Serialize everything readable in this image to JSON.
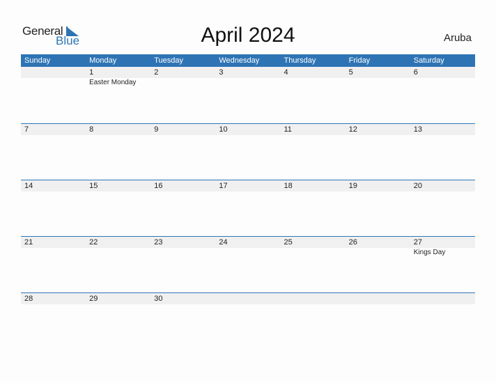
{
  "logo": {
    "word1": "General",
    "word2": "Blue",
    "icon": "triangle-flag-icon",
    "brand_color": "#2e74b5"
  },
  "title": "April 2024",
  "country": "Aruba",
  "header_color": "#2e74b5",
  "days": [
    "Sunday",
    "Monday",
    "Tuesday",
    "Wednesday",
    "Thursday",
    "Friday",
    "Saturday"
  ],
  "weeks": [
    {
      "dates": [
        "",
        "1",
        "2",
        "3",
        "4",
        "5",
        "6"
      ],
      "events": [
        "",
        "Easter Monday",
        "",
        "",
        "",
        "",
        ""
      ]
    },
    {
      "dates": [
        "7",
        "8",
        "9",
        "10",
        "11",
        "12",
        "13"
      ],
      "events": [
        "",
        "",
        "",
        "",
        "",
        "",
        ""
      ]
    },
    {
      "dates": [
        "14",
        "15",
        "16",
        "17",
        "18",
        "19",
        "20"
      ],
      "events": [
        "",
        "",
        "",
        "",
        "",
        "",
        ""
      ]
    },
    {
      "dates": [
        "21",
        "22",
        "23",
        "24",
        "25",
        "26",
        "27"
      ],
      "events": [
        "",
        "",
        "",
        "",
        "",
        "",
        "Kings Day"
      ]
    },
    {
      "dates": [
        "28",
        "29",
        "30",
        "",
        "",
        "",
        ""
      ],
      "events": [
        "",
        "",
        "",
        "",
        "",
        "",
        ""
      ]
    }
  ]
}
